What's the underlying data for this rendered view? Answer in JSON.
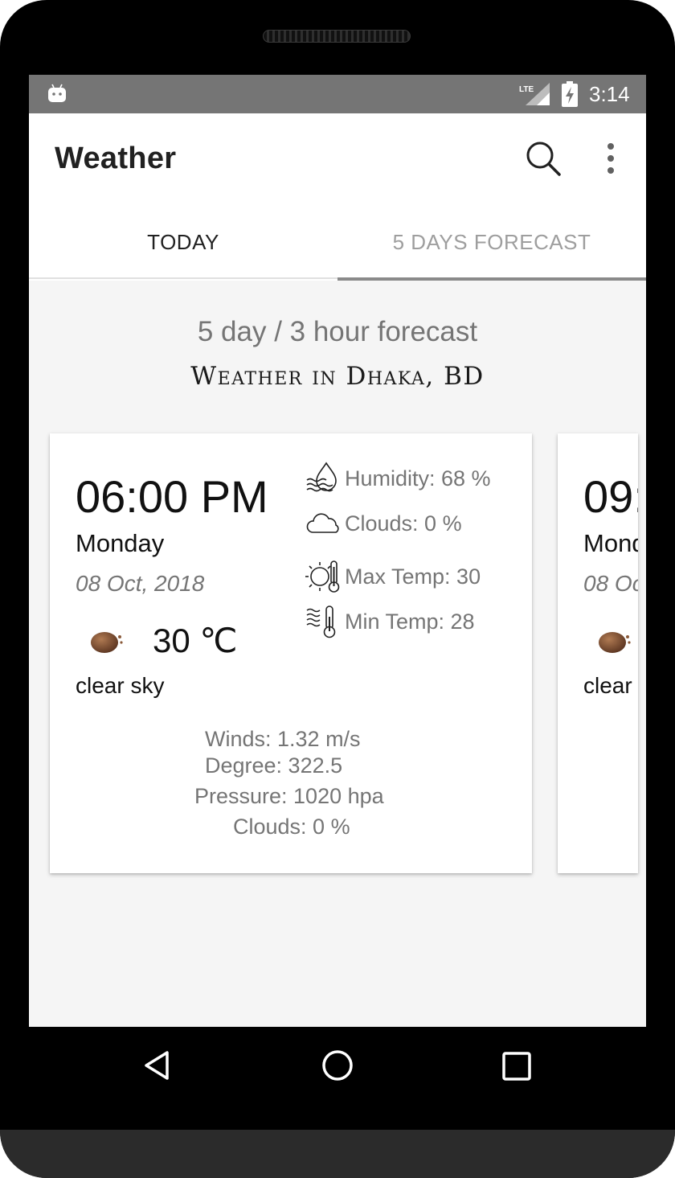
{
  "status_bar": {
    "time": "3:14",
    "network": "LTE",
    "icons": [
      "android-icon",
      "lte-signal-icon",
      "battery-charging-icon"
    ]
  },
  "app_bar": {
    "title": "Weather",
    "actions": [
      "search-icon",
      "more-vert-icon"
    ]
  },
  "tabs": [
    {
      "label": "TODAY",
      "selected": false
    },
    {
      "label": "5 DAYS FORECAST",
      "selected": true
    }
  ],
  "content": {
    "title": "5 day / 3 hour forecast",
    "subtitle": "Weather in Dhaka, BD"
  },
  "cards": [
    {
      "time": "06:00 PM",
      "day": "Monday",
      "date": "08 Oct, 2018",
      "weather_icon": "clear-sky-night-icon",
      "temp": "30 ℃",
      "description": "clear sky",
      "details": {
        "humidity": "Humidity: 68 %",
        "clouds": "Clouds: 0 %",
        "max_temp": "Max Temp: 30",
        "min_temp": "Min Temp: 28"
      },
      "winds": "Winds: 1.32 m/s",
      "degree": "Degree: 322.5",
      "pressure": "Pressure: 1020 hpa",
      "clouds_bottom": "Clouds: 0 %"
    },
    {
      "time": "09:",
      "day": "Mond",
      "date": "08 Oc",
      "weather_icon": "clear-sky-night-icon",
      "description": "clear"
    }
  ],
  "colors": {
    "status_bar": "#757575",
    "app_bar": "#ffffff",
    "tab_indicator": "#8a8a8a",
    "secondary_text": "#757575",
    "background": "#f5f5f5"
  },
  "nav_bar": [
    "back-icon",
    "home-icon",
    "recents-icon"
  ]
}
